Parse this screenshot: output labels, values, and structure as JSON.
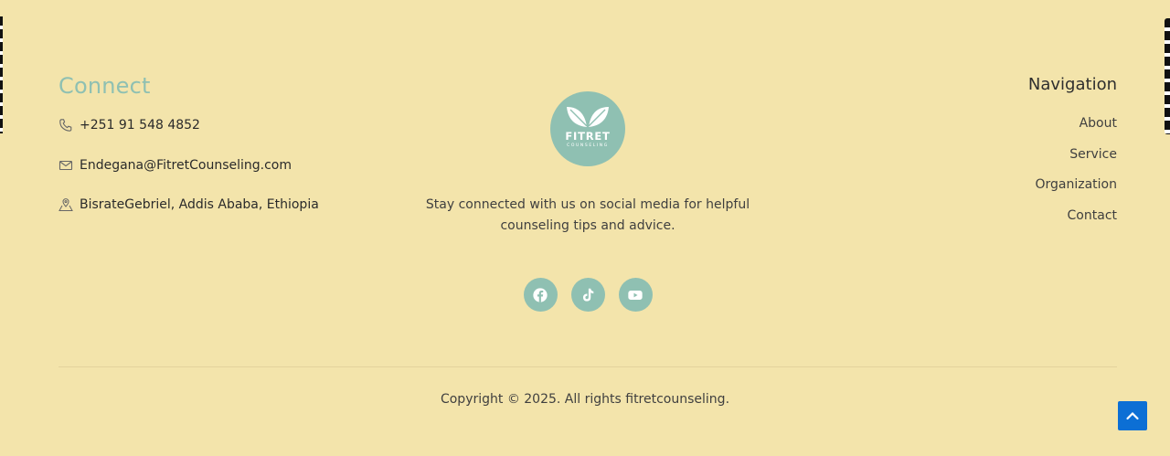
{
  "connect": {
    "title": "Connect",
    "items": [
      {
        "icon": "phone-icon",
        "text": "+251 91 548 4852"
      },
      {
        "icon": "mail-icon",
        "text": "Endegana@FitretCounseling.com"
      },
      {
        "icon": "location-icon",
        "text": "BisrateGebriel, Addis Ababa, Ethiopia"
      }
    ]
  },
  "brand": {
    "logo_text": "FITRET",
    "logo_sub": "COUNSELING",
    "tagline": "Stay connected with us on social media for helpful counseling tips and advice."
  },
  "socials": [
    {
      "icon": "facebook-icon"
    },
    {
      "icon": "tiktok-icon"
    },
    {
      "icon": "youtube-icon"
    }
  ],
  "navigation": {
    "title": "Navigation",
    "items": [
      "About",
      "Service",
      "Organization",
      "Contact"
    ]
  },
  "footer": {
    "copyright": "Copyright © 2025. All rights fitretcounseling."
  },
  "colors": {
    "background": "#f3e4ab",
    "accent": "#8fc0b2",
    "scroll_button": "#0c6fd5"
  }
}
